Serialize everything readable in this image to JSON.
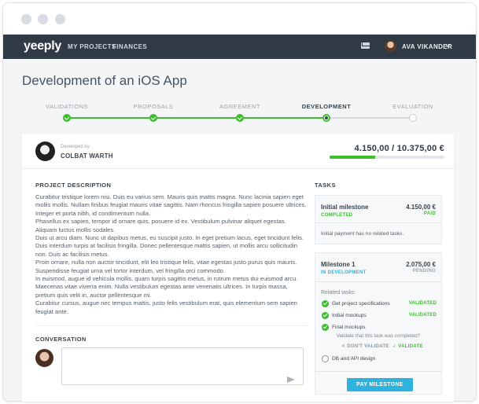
{
  "app": {
    "logo": "yeeply"
  },
  "nav": {
    "links": [
      "MY PROJECTS",
      "FINANCES"
    ],
    "user_name": "AVA VIKANDER"
  },
  "project": {
    "title": "Development of an iOS App"
  },
  "steps": [
    {
      "label": "VALIDATIONS",
      "state": "done"
    },
    {
      "label": "PROPOSALS",
      "state": "done"
    },
    {
      "label": "AGREEMENT",
      "state": "done"
    },
    {
      "label": "DEVELOPMENT",
      "state": "current"
    },
    {
      "label": "EVALUATION",
      "state": "pending"
    }
  ],
  "developer": {
    "label": "Developed by:",
    "name": "COLBAT WARTH"
  },
  "budget": {
    "amount_text": "4.150,00 / 10.375,00 €",
    "progress_fraction": 0.4
  },
  "description": {
    "heading": "PROJECT DESCRIPTION",
    "paragraphs": [
      "Curabitur tristique lorem nisi. Duis eu varius sem. Mauris quis mattis magna. Nunc lacinia sapien eget mollis mollis. Nullam finibus feugiat mauris vitae sagittis. Nam rhoncus fringilla sapien posuere ultrices. Integer et porta nibh, id condimentum nulla.",
      "Phasellus ex sapien, tempor id ornare quis, posuere id ex. Vestibulum pulvinar aliquet egestas. Aliquam luctus mollis sodales.",
      "Duis ut arcu diam. Nunc ut dapibus metus, eu suscipit justo. In eget pretium lacus, eget tincidunt felis. Duis interdum turpis at facilisis fringilla. Donec pellentesque mattis sapien, ut mollis arcu sollicitudin non. Duis ac facilisis metus.",
      "Proin ornare, nulla non auctor tincidunt, elit leo tristique felis, vitae egestas justo purus quis mauris. Suspendisse feugiat urna vel tortor interdum, vel fringilla orci commodo.",
      "In euismod, augue id vehicula mollis, quam turpis sagittis metus, in rutrum metus dui euismod arcu. Maecenas vitae viverra enim. Nulla vestibulum egestas ante venenatis ultrices. In turpis massa, pretium quis velit in, auctor pellentesque mi.",
      "Curabitur cursus, augue nec tempus mattis, justo felis vestibulum erat, quis elementum sem sapien feugiat ante."
    ]
  },
  "conversation": {
    "heading": "CONVERSATION",
    "input_value": ""
  },
  "tasks": {
    "heading": "TASKS",
    "milestone1": {
      "title": "Initial milestone",
      "amount": "4.150,00 €",
      "status": "COMPLETED",
      "payment": "PAID",
      "note": "Initial payment has no related tasks."
    },
    "milestone2": {
      "title": "Milestone 1",
      "amount": "2.075,00 €",
      "status": "IN DEVELOPMENT",
      "payment": "PENDING",
      "related_label": "Related tasks:",
      "items": [
        {
          "name": "Get project specifications",
          "status": "VALIDATED",
          "checked": true
        },
        {
          "name": "Initial mockups",
          "status": "VALIDATED",
          "checked": true
        },
        {
          "name": "Final mockups",
          "status": "",
          "checked": true
        },
        {
          "name": "DB and API design",
          "status": "",
          "checked": false
        }
      ],
      "validate_question": "Validate that this task was completed?",
      "dont_validate": "DON'T VALIDATE",
      "validate": "VALIDATE"
    },
    "pay_button": "PAY MILESTONE"
  },
  "colors": {
    "accent_green": "#3dbd2e",
    "navbar": "#2f3a45",
    "pay_blue": "#2db3dd",
    "link_blue": "#2db3dd"
  }
}
